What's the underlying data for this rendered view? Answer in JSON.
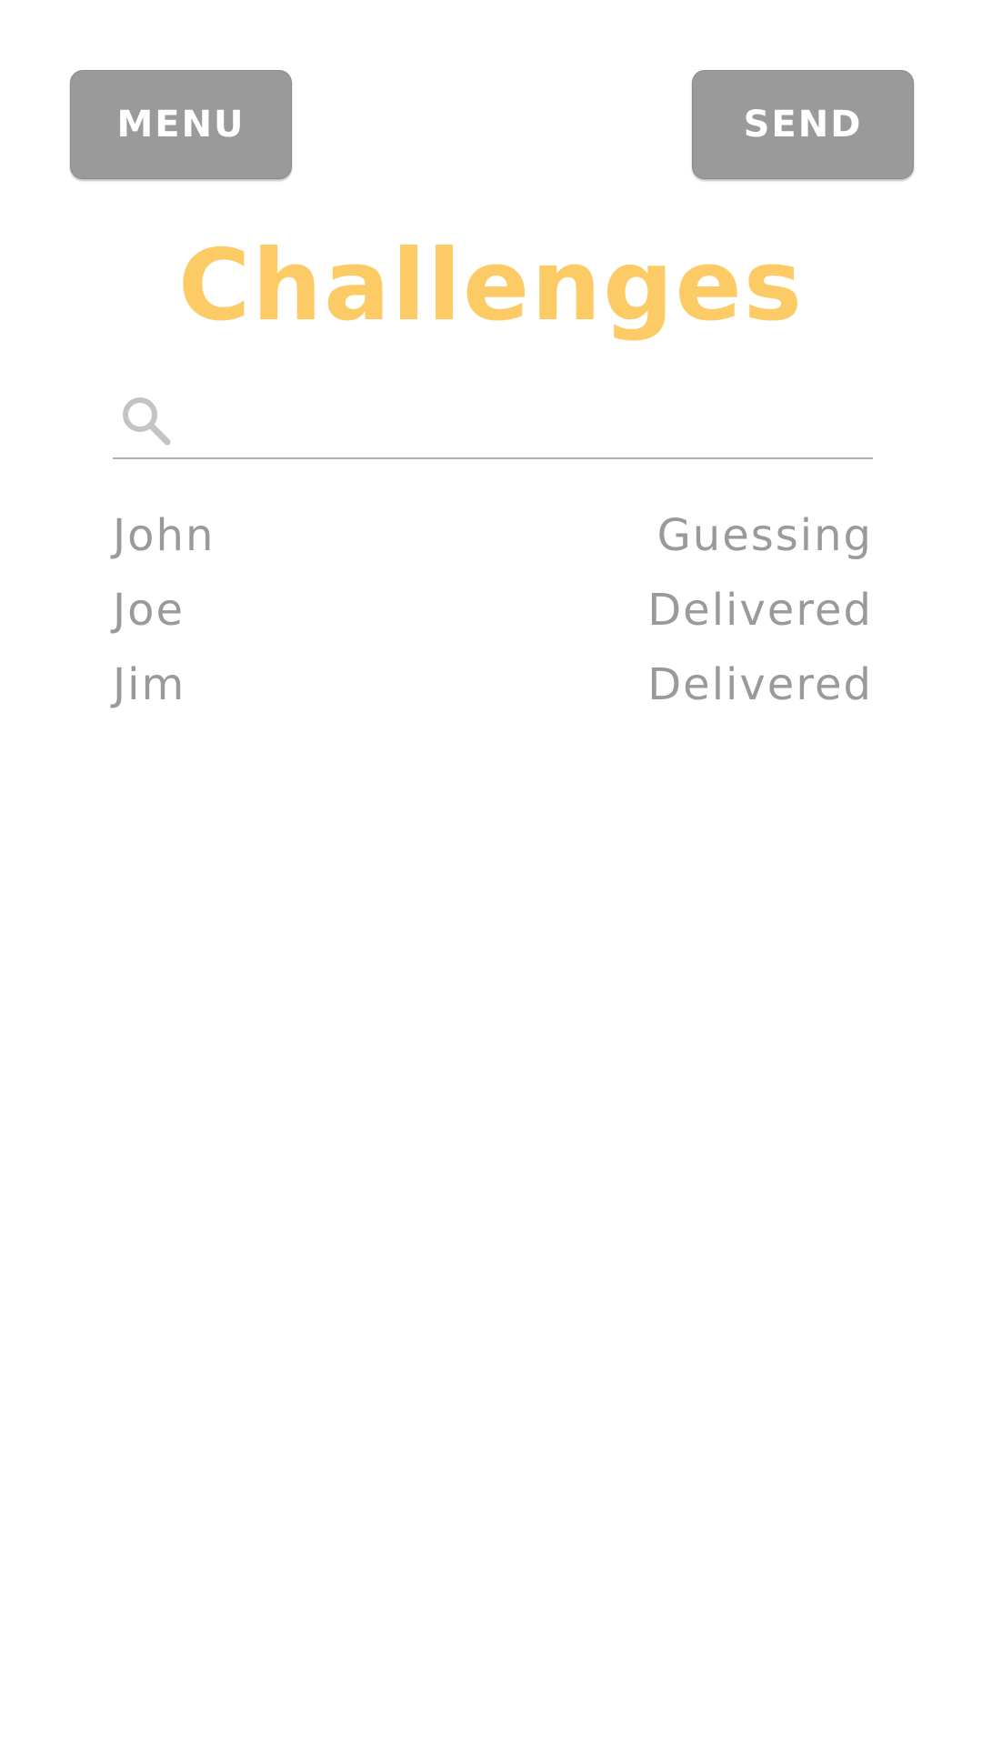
{
  "header": {
    "menu_label": "MENU",
    "send_label": "SEND",
    "title": "Challenges"
  },
  "search": {
    "placeholder": "",
    "value": "",
    "icon": "search-icon"
  },
  "challenges": [
    {
      "name": "John",
      "status": "Guessing"
    },
    {
      "name": "Joe",
      "status": "Delivered"
    },
    {
      "name": "Jim",
      "status": "Delivered"
    }
  ],
  "colors": {
    "title": "#fdcb66",
    "button_bg": "#9a9a9a",
    "text": "#9a9a9a",
    "divider": "#b0b0b0"
  }
}
